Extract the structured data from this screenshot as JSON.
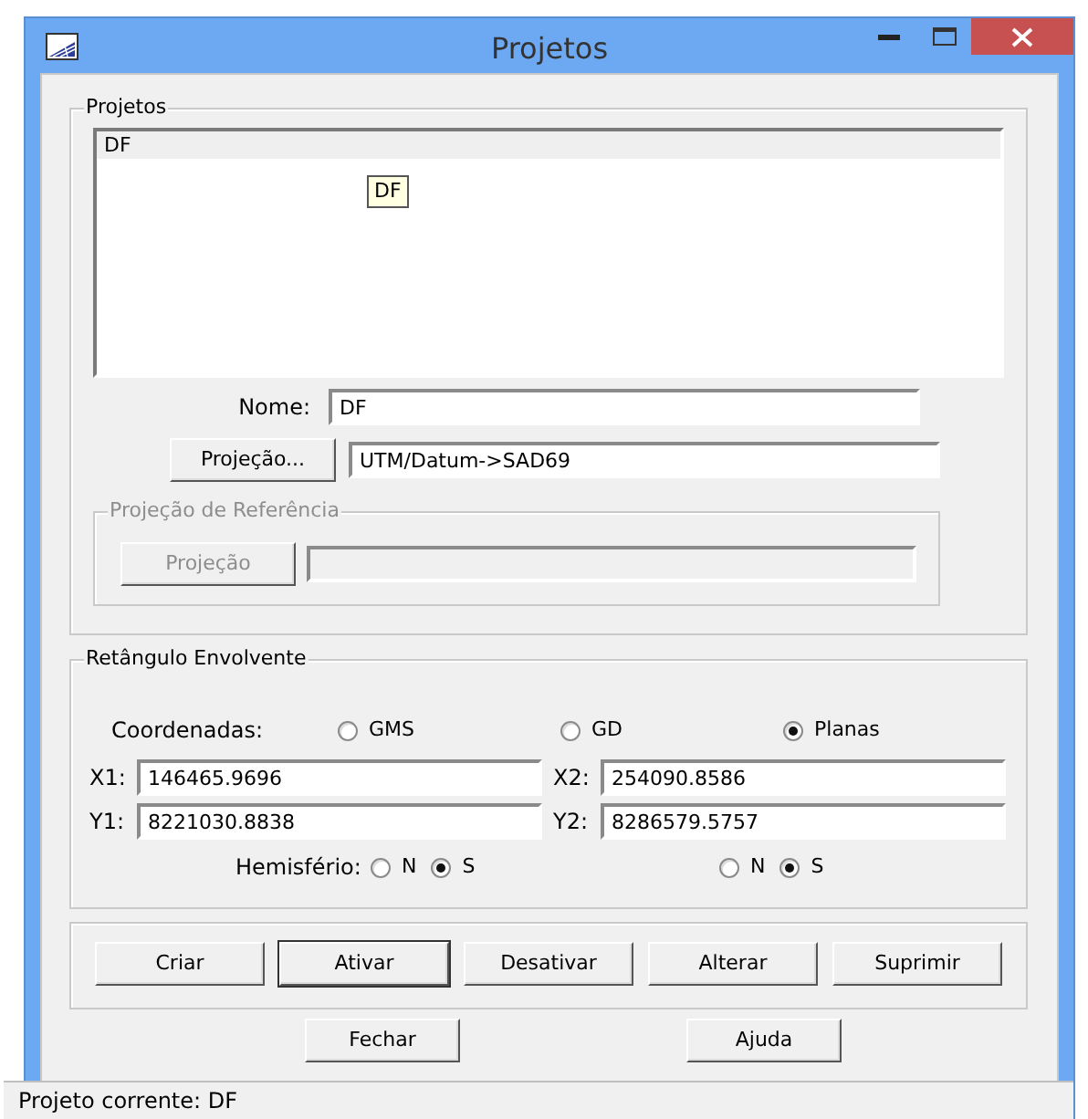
{
  "window": {
    "title": "Projetos"
  },
  "projects_group": {
    "label": "Projetos",
    "list": [
      {
        "text": "DF",
        "selected": true
      }
    ],
    "tooltip": "DF",
    "name_label": "Nome:",
    "name_value": "DF",
    "projection_button": "Projeção...",
    "projection_value": "UTM/Datum->SAD69",
    "reference": {
      "label": "Projeção de Referência",
      "disabled": true,
      "button": "Projeção"
    }
  },
  "bbox_group": {
    "label": "Retângulo Envolvente",
    "coord_label": "Coordenadas:",
    "coord_options": [
      {
        "label": "GMS",
        "selected": false
      },
      {
        "label": "GD",
        "selected": false
      },
      {
        "label": "Planas",
        "selected": true
      }
    ],
    "fields": [
      {
        "label": "X1:",
        "value": "146465.9696"
      },
      {
        "label": "X2:",
        "value": "254090.8586"
      },
      {
        "label": "Y1:",
        "value": "8221030.8838"
      },
      {
        "label": "Y2:",
        "value": "8286579.5757"
      }
    ],
    "hemisphere_label": "Hemisfério:",
    "hemispheres": [
      [
        {
          "label": "N",
          "selected": false
        },
        {
          "label": "S",
          "selected": true
        }
      ],
      [
        {
          "label": "N",
          "selected": false
        },
        {
          "label": "S",
          "selected": true
        }
      ]
    ]
  },
  "action_buttons": [
    {
      "label": "Criar",
      "default": false
    },
    {
      "label": "Ativar",
      "default": true
    },
    {
      "label": "Desativar",
      "default": false
    },
    {
      "label": "Alterar",
      "default": false
    },
    {
      "label": "Suprimir",
      "default": false
    }
  ],
  "bottom_buttons": [
    "Fechar",
    "Ajuda"
  ],
  "status_bar": "Projeto corrente: DF"
}
